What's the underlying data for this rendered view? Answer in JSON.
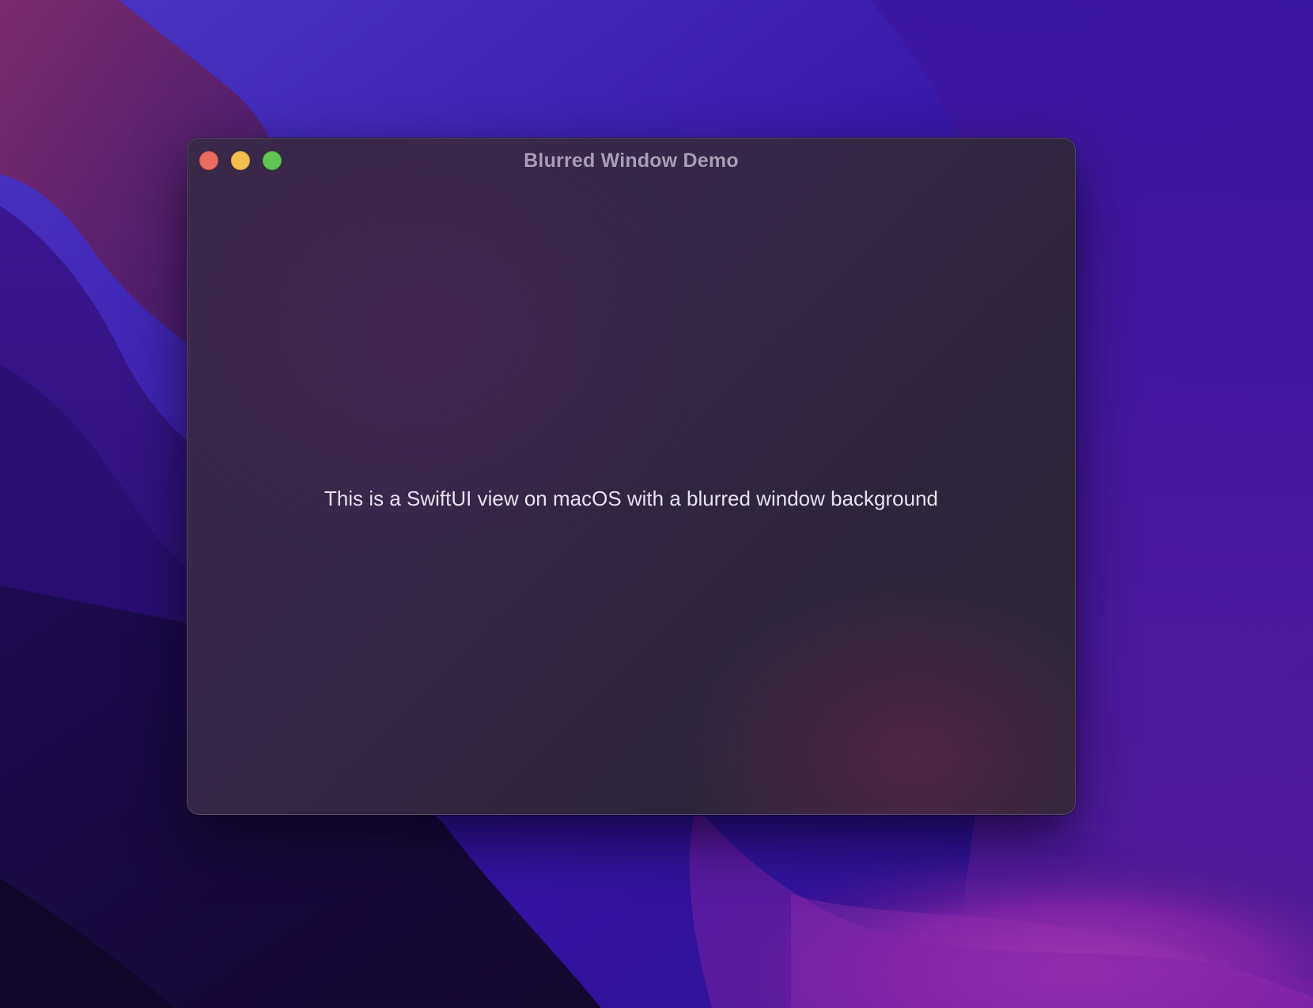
{
  "desktop": {
    "wallpaper_colors": {
      "base": "#2a1266",
      "top": "#3a1aa8",
      "magenta_left": "#5e1f6e",
      "violet_bottom_right": "#8a2aa8",
      "deep_bottom_left": "#160a3a"
    }
  },
  "window": {
    "title": "Blurred Window Demo",
    "traffic_lights": {
      "close": "close-icon",
      "minimize": "minimize-icon",
      "zoom": "zoom-icon"
    },
    "content": {
      "message": "This is a SwiftUI view on macOS with a blurred window background"
    }
  }
}
